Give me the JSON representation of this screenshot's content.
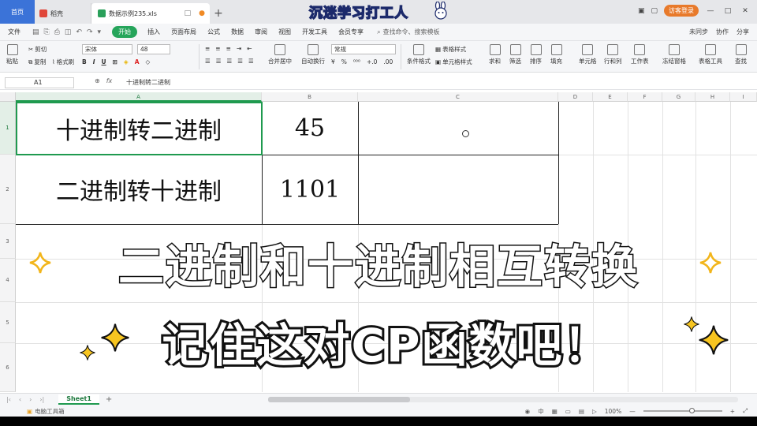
{
  "titlebar": {
    "home_tab": "首页",
    "doc_tab": "稻壳",
    "file_tab": "数据示例235.xls",
    "login": "访客登录",
    "minimize": "—",
    "maximize": "□",
    "close": "✕"
  },
  "watermark": "沉迷学习打工人",
  "menu": {
    "file": "文件",
    "start": "开始",
    "items": [
      "插入",
      "页面布局",
      "公式",
      "数据",
      "审阅",
      "视图",
      "开发工具",
      "会员专享"
    ],
    "search": "查找命令、搜索模板",
    "right": [
      "未同步",
      "协作",
      "分享"
    ]
  },
  "ribbon": {
    "paste": "粘贴",
    "cut": "剪切",
    "copy": "复制",
    "format_painter": "格式刷",
    "font": "宋体",
    "font_size": "48",
    "merge": "合并居中",
    "wrap": "自动换行",
    "number_format": "常规",
    "table_style": "表格样式",
    "cond_format": "条件格式",
    "cell_style": "单元格样式",
    "tools": [
      "求和",
      "筛选",
      "排序",
      "填充",
      "单元格",
      "行和列",
      "工作表",
      "冻结窗格",
      "表格工具",
      "查找"
    ]
  },
  "formula_bar": {
    "cell_ref": "A1",
    "fx": "fx",
    "value": "十进制转二进制"
  },
  "grid": {
    "columns": [
      "A",
      "B",
      "C",
      "D",
      "E",
      "F",
      "G",
      "H",
      "I"
    ],
    "rows": [
      "1",
      "2",
      "3",
      "4",
      "5",
      "6"
    ],
    "cells": {
      "A1": "十进制转二进制",
      "B1": "45",
      "A2": "二进制转十进制",
      "B2": "1101"
    }
  },
  "overlay": {
    "caption1": "二进制和十进制相互转换",
    "caption2": "记住这对CP函数吧！"
  },
  "sheets": {
    "active": "Sheet1",
    "add": "+"
  },
  "status": {
    "left": "电脑工具箱",
    "zoom": "100%",
    "lang": "中"
  },
  "colors": {
    "accent_green": "#1f9a4f",
    "tab_blue": "#3b73d8",
    "caption_gold": "#f2b51a"
  }
}
